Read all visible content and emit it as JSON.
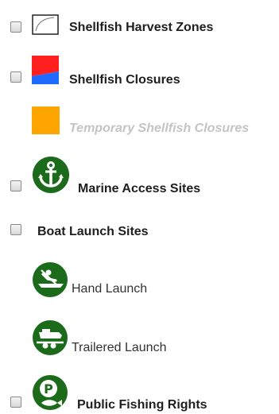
{
  "layers": {
    "harvest_zones": {
      "label": "Shellfish Harvest Zones",
      "checked": false,
      "icon": "harvest-zone-polygon-icon"
    },
    "closures": {
      "label": "Shellfish Closures",
      "checked": false,
      "icon": "closure-swatch-icon",
      "colors": [
        "#ff1f1f",
        "#1f6bff"
      ]
    },
    "temporary_closures": {
      "label": "Temporary Shellfish Closures",
      "icon": "temporary-closure-swatch-icon",
      "color": "#ffa500",
      "state": "disabled"
    },
    "marine_access": {
      "label": "Marine Access Sites",
      "checked": false,
      "icon": "anchor-icon",
      "color": "#1b6b1b"
    },
    "boat_launch": {
      "label": "Boat Launch Sites",
      "checked": false
    },
    "hand_launch": {
      "label": "Hand Launch",
      "icon": "kayak-icon",
      "color": "#1b6b1b"
    },
    "trailered_launch": {
      "label": "Trailered Launch",
      "icon": "boat-trailer-icon",
      "color": "#1b6b1b"
    },
    "fishing_rights": {
      "label": "Public Fishing Rights",
      "checked": false,
      "icon": "fishing-rights-icon",
      "color": "#1b6b1b"
    }
  }
}
